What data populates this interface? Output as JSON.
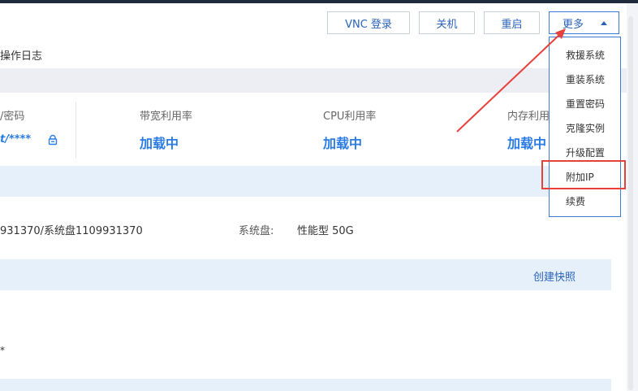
{
  "header": {
    "vnc_label": "VNC 登录",
    "shutdown_label": "关机",
    "restart_label": "重启",
    "more_label": "更多"
  },
  "tabs": {
    "oplog_label": "操作日志"
  },
  "metrics": {
    "password_label": "/密码",
    "password_value": "t/****",
    "bandwidth_label": "带宽利用率",
    "bandwidth_value": "加载中",
    "cpu_label": "CPU利用率",
    "cpu_value": "加载中",
    "memory_label": "内存利用",
    "memory_value": "加载中"
  },
  "disk": {
    "info": "931370/系统盘1109931370",
    "label": "系统盘:",
    "value": "性能型 50G"
  },
  "snapshot": {
    "create_label": "创建快照"
  },
  "misc": {
    "asterisk": "*"
  },
  "dropdown": {
    "items": [
      "救援系统",
      "重装系统",
      "重置密码",
      "克隆实例",
      "升级配置",
      "附加IP",
      "续费"
    ],
    "highlighted": "附加IP"
  },
  "colors": {
    "accent": "#2a7be4",
    "link": "#2a62b8",
    "annotation": "#e8403a"
  }
}
